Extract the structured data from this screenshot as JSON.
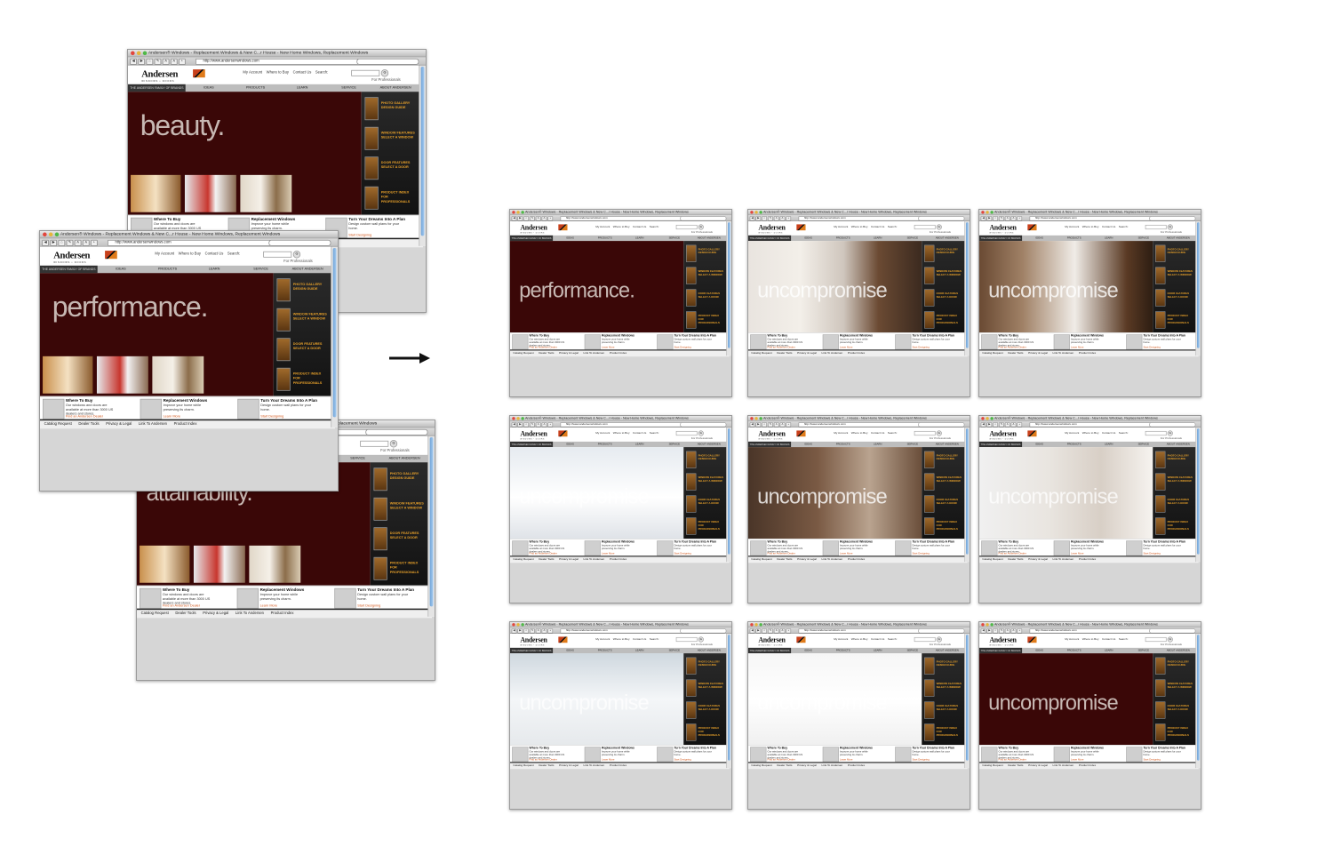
{
  "browser": {
    "window_title_short": "Andersen® Windows - Replacement Windows & New C...r House - New Home Windows, Replacement Windows",
    "url": "http://www.andersenwindows.com",
    "traffic_colors": [
      "#e2453c",
      "#e6b63a",
      "#4fb847"
    ]
  },
  "site": {
    "logo": "Andersen",
    "logo_sub": "WINDOWS • DOORS",
    "top_links": [
      "My Account",
      "Where to Buy",
      "Contact Us",
      "Search:"
    ],
    "search_go": "G",
    "for_professionals": "For Professionals",
    "nav": {
      "family": "THE ANDERSEN FAMILY OF BRANDS",
      "items": [
        "IDEAS",
        "PRODUCTS",
        "LEARN",
        "SERVICE",
        "ABOUT ANDERSEN"
      ]
    },
    "side": [
      {
        "line1": "PHOTO GALLERY",
        "line2": "DESIGN GUIDE"
      },
      {
        "line1": "WINDOW FEATURES",
        "line2": "SELECT A WINDOW"
      },
      {
        "line1": "DOOR FEATURES",
        "line2": "SELECT A DOOR"
      },
      {
        "line1": "PRODUCT INDEX FOR",
        "line2": "PROFESSIONALS"
      }
    ],
    "bottom": [
      {
        "heading": "Where To Buy",
        "text": "Our windows and doors are available at more than 3000 US dealers and stores.",
        "link": "Find an Andersen Dealer"
      },
      {
        "heading": "Replacement Windows",
        "text": "Improve your home while preserving its charm.",
        "link": "Learn More"
      },
      {
        "heading": "Turn Your Dreams Into A Plan",
        "text": "Design custom wall plans for your home.",
        "link": "Start Designing"
      }
    ],
    "footer": [
      "Catalog Request",
      "Dealer Tools",
      "Privacy & Legal",
      "Link To Andersen",
      "Product Index"
    ]
  },
  "frames": {
    "left": [
      "beauty.",
      "performance.",
      "attainability."
    ],
    "grid": [
      "performance.",
      "uncompromise",
      "uncompromise",
      "uncompromise",
      "uncompromise",
      "uncompromise",
      "uncompromise",
      "uncompromise",
      "uncompromise"
    ]
  }
}
